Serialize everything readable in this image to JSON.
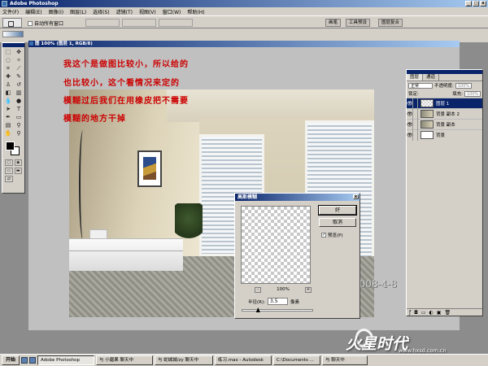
{
  "app": {
    "title": "Adobe Photoshop"
  },
  "menu": [
    "文件(F)",
    "编辑(E)",
    "图像(I)",
    "图层(L)",
    "选择(S)",
    "滤镜(T)",
    "视图(V)",
    "窗口(W)",
    "帮助(H)"
  ],
  "options": {
    "auto_select_label": "自动所有窗口",
    "palette_wells": [
      "画笔",
      "工具预设",
      "图层复合"
    ]
  },
  "document": {
    "title": "图 100% (图层 1, RGB/8)"
  },
  "notes": [
    "我这个是做图比较小，所以给的",
    "也比较小，这个看情况来定的",
    "模糊过后我们在用橡皮把不需要",
    "模糊的地方干掉"
  ],
  "signature": "陈燕2008-4-8",
  "layers_panel": {
    "tabs": [
      "图层",
      "通道"
    ],
    "blend_mode": "正常",
    "opacity_label": "不透明度:",
    "opacity_value": "100%",
    "fill_label": "填充:",
    "fill_value": "100%",
    "lock_label": "锁定:",
    "layers": [
      {
        "name": "图层 1",
        "thumb": "checker",
        "active": true
      },
      {
        "name": "背景 副本 2",
        "thumb": "photo",
        "active": false
      },
      {
        "name": "背景 副本",
        "thumb": "photo",
        "active": false
      },
      {
        "name": "背景",
        "thumb": "white",
        "active": false
      }
    ]
  },
  "gaussian_blur": {
    "title": "高斯模糊",
    "ok_label": "好",
    "cancel_label": "取消",
    "preview_label": "预览(P)",
    "preview_checked": true,
    "zoom_value": "100%",
    "radius_label": "半径(R):",
    "radius_value": "3.5",
    "radius_unit": "像素",
    "radius_fraction": 0.2
  },
  "taskbar": {
    "start_label": "开始",
    "tasks": [
      "Adobe Photoshop",
      "与 小磨果 聊天中",
      "与 蛇缄城/zy 聊天中",
      "练习.max - Autodesk",
      "C:\\Documents ...",
      "与 聊天中"
    ]
  },
  "watermark": {
    "logo_text": "火星时代",
    "url": "www.hxsd.com.cn"
  },
  "colors": {
    "titlebar": "#0a246a",
    "note_text": "#cc0000",
    "panel_bg": "#d4d0c8"
  }
}
